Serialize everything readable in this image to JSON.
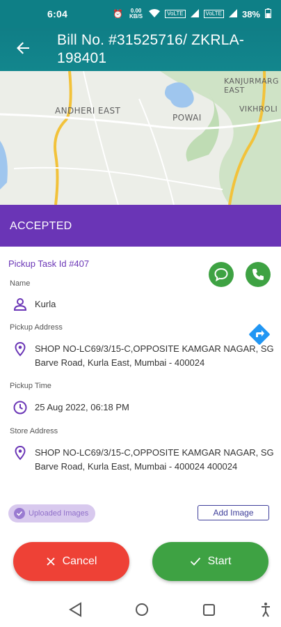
{
  "status_bar": {
    "time": "6:04",
    "data_speed": "0.00\nKB/S",
    "network1": "VoLTE",
    "network2": "VoLTE",
    "battery": "38%"
  },
  "app_bar": {
    "title": "Bill No. #31525716/ ZKRLA-198401",
    "back_icon": "arrow-back-icon"
  },
  "map": {
    "labels": {
      "andheri": "ANDHERI EAST",
      "powai": "POWAI",
      "kanjurmarg": "KANJURMARG EAST",
      "vikhroli": "VIKHROLI"
    }
  },
  "status_banner": {
    "text": "ACCEPTED",
    "color": "#6a35b6"
  },
  "task": {
    "task_id": "Pickup Task Id #407",
    "name_label": "Name",
    "name": "Kurla",
    "pickup_address_label": "Pickup Address",
    "pickup_address": "SHOP NO-LC69/3/15-C,OPPOSITE KAMGAR NAGAR, SG Barve Road, Kurla East, Mumbai - 400024",
    "pickup_time_label": "Pickup Time",
    "pickup_time": "25 Aug 2022, 06:18 PM",
    "store_address_label": "Store Address",
    "store_address": "SHOP NO-LC69/3/15-C,OPPOSITE KAMGAR NAGAR, SG Barve Road, Kurla East, Mumbai - 400024 400024"
  },
  "actions": {
    "uploaded_images": "Uploaded Images",
    "add_image": "Add Image",
    "cancel": "Cancel",
    "start": "Start"
  },
  "colors": {
    "teal": "#0e7f86",
    "purple": "#6a35b6",
    "green": "#3ea243",
    "red": "#ee4136",
    "direction_blue": "#2196f3"
  }
}
